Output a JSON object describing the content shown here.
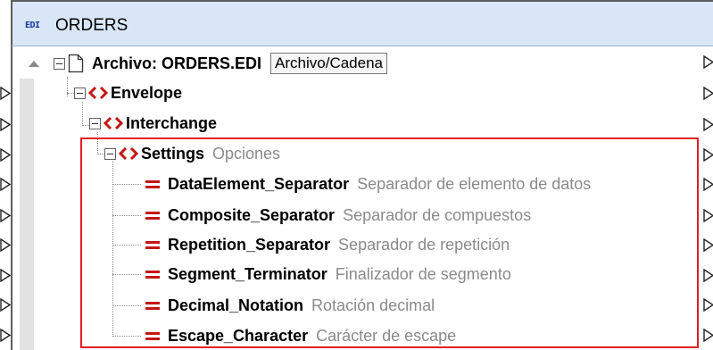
{
  "window": {
    "badge": "EDI",
    "title": "ORDERS"
  },
  "root": {
    "label": "Archivo: ORDERS.EDI",
    "button_label": "Archivo/Cadena"
  },
  "nodes": [
    {
      "name": "Envelope",
      "annotation": ""
    },
    {
      "name": "Interchange",
      "annotation": ""
    },
    {
      "name": "Settings",
      "annotation": "Opciones"
    }
  ],
  "settings_items": [
    {
      "name": "DataElement_Separator",
      "annotation": "Separador de elemento de datos"
    },
    {
      "name": "Composite_Separator",
      "annotation": "Separador de compuestos"
    },
    {
      "name": "Repetition_Separator",
      "annotation": "Separador de repetición"
    },
    {
      "name": "Segment_Terminator",
      "annotation": "Finalizador de segmento"
    },
    {
      "name": "Decimal_Notation",
      "annotation": "Rotación decimal"
    },
    {
      "name": "Escape_Character",
      "annotation": "Carácter de escape"
    }
  ],
  "colors": {
    "element_icon": "#c41616",
    "highlight": "#e31b23",
    "title_bar": "#d8e6f7"
  },
  "icons": {
    "element": "angle-brackets-icon",
    "attribute": "equals-icon",
    "file": "file-icon",
    "collapse": "minus-box-icon",
    "port": "triangle-port-icon"
  }
}
